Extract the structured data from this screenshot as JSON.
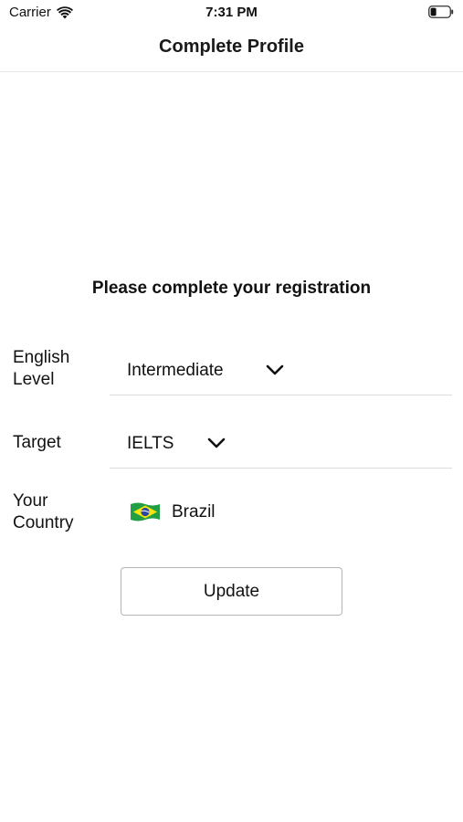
{
  "status_bar": {
    "carrier": "Carrier",
    "time": "7:31 PM",
    "wifi_icon": "wifi-icon",
    "battery_icon": "battery-icon"
  },
  "nav": {
    "title": "Complete Profile"
  },
  "form": {
    "heading": "Please complete your registration",
    "english_level": {
      "label": "English Level",
      "value": "Intermediate",
      "icon": "chevron-down-icon"
    },
    "target": {
      "label": "Target",
      "value": "IELTS",
      "icon": "chevron-down-icon"
    },
    "country": {
      "label": "Your Country",
      "value": "Brazil",
      "icon": "brazil-flag-icon"
    },
    "update_label": "Update"
  },
  "colors": {
    "background": "#ffffff",
    "text": "#111111",
    "divider": "#dcdcdc",
    "button_border": "#b5b5b5",
    "flag_green": "#229e45",
    "flag_yellow": "#f8e509",
    "flag_blue": "#2b49a3"
  }
}
